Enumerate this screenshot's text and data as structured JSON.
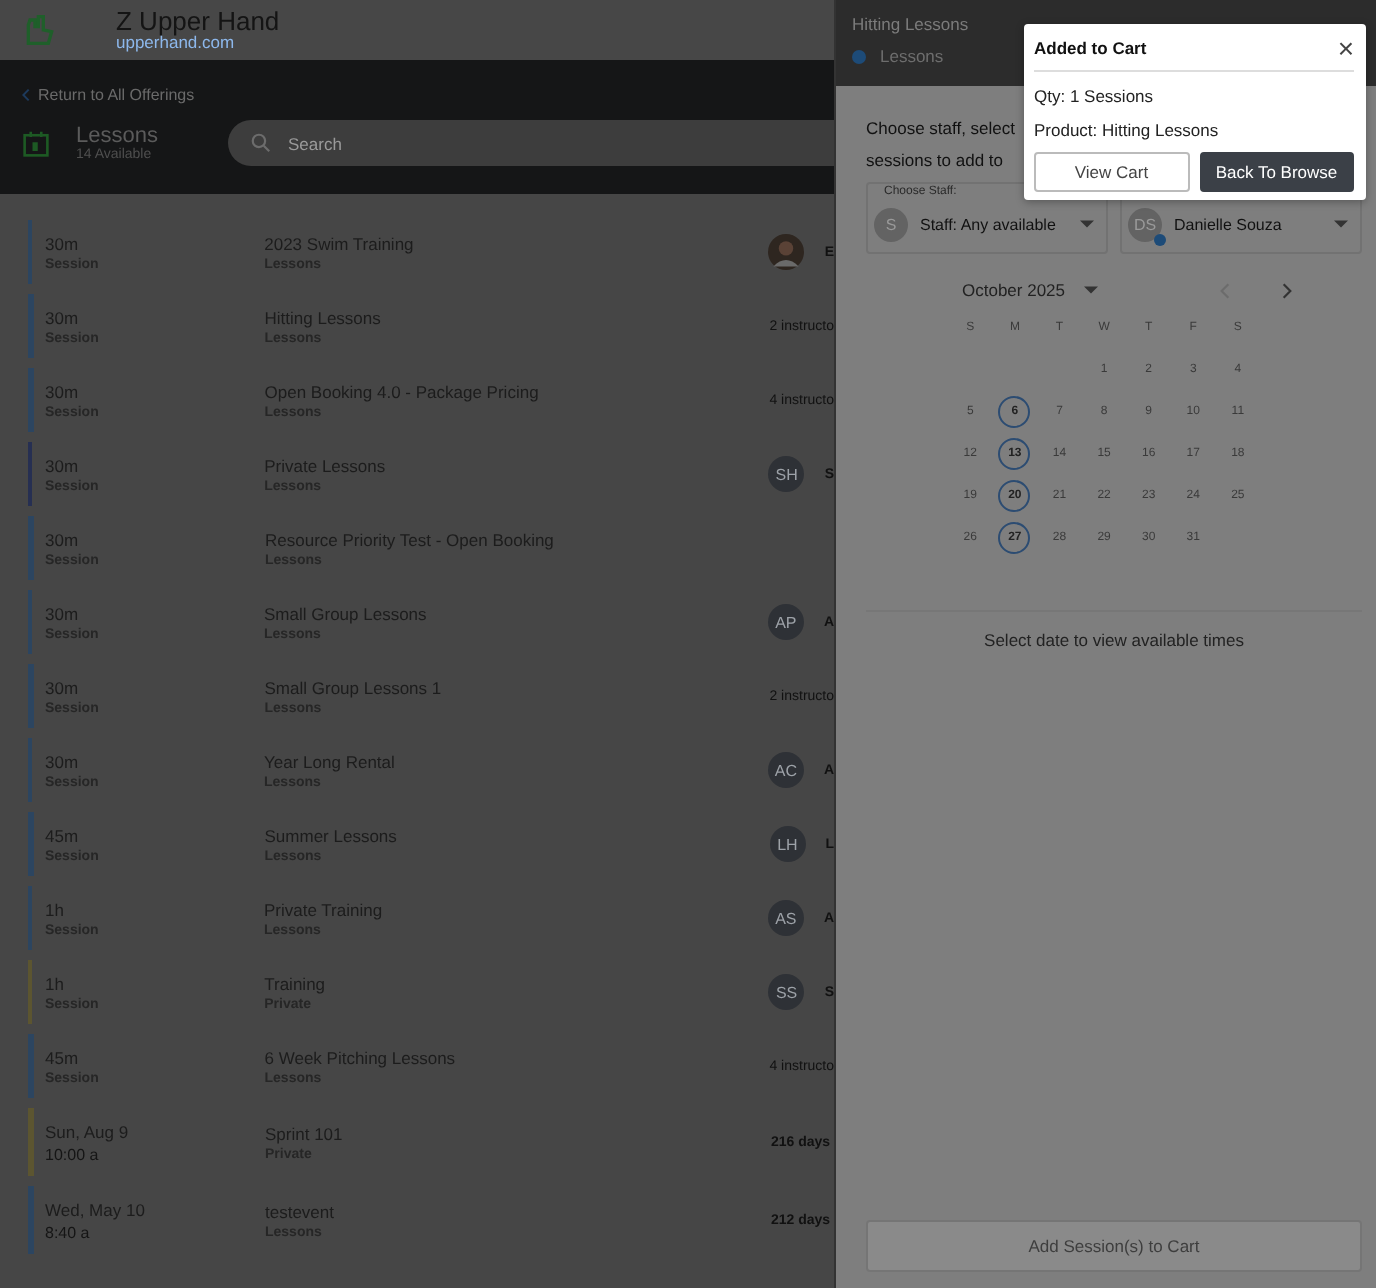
{
  "brand": {
    "name": "Z Upper Hand",
    "site": "upperhand.com"
  },
  "header": {
    "back_link": "Return to All Offerings",
    "title": "Lessons",
    "count": "14 Available",
    "search": {
      "placeholder": "Search"
    }
  },
  "rows": [
    {
      "when": "30m",
      "sub": "Session",
      "name": "2023 Swim Training",
      "category": "Lessons",
      "color": "#2c4560",
      "side": {
        "kind": "photo",
        "text": "E"
      }
    },
    {
      "when": "30m",
      "sub": "Session",
      "name": "Hitting Lessons",
      "category": "Lessons",
      "color": "#2c4560",
      "side": {
        "kind": "text",
        "text": "2 instructo"
      }
    },
    {
      "when": "30m",
      "sub": "Session",
      "name": "Open Booking 4.0 - Package Pricing",
      "category": "Lessons",
      "color": "#2c4560",
      "side": {
        "kind": "text",
        "text": "4 instructo"
      }
    },
    {
      "when": "30m",
      "sub": "Session",
      "name": "Private Lessons",
      "category": "Lessons",
      "color": "#262f52",
      "side": {
        "kind": "avatar",
        "initials": "SH",
        "text": "S"
      }
    },
    {
      "when": "30m",
      "sub": "Session",
      "name": "Resource Priority Test - Open Booking",
      "category": "Lessons",
      "color": "#2c4560"
    },
    {
      "when": "30m",
      "sub": "Session",
      "name": "Small Group Lessons",
      "category": "Lessons",
      "color": "#2c4560",
      "side": {
        "kind": "avatar",
        "initials": "AP",
        "text": "A"
      }
    },
    {
      "when": "30m",
      "sub": "Session",
      "name": "Small Group Lessons 1",
      "category": "Lessons",
      "color": "#2c4560",
      "side": {
        "kind": "text",
        "text": "2 instructo"
      }
    },
    {
      "when": "30m",
      "sub": "Session",
      "name": "Year Long Rental",
      "category": "Lessons",
      "color": "#2c4560",
      "side": {
        "kind": "avatar",
        "initials": "AC",
        "text": "A"
      }
    },
    {
      "when": "45m",
      "sub": "Session",
      "name": "Summer Lessons",
      "category": "Lessons",
      "color": "#2c4560",
      "side": {
        "kind": "avatar",
        "initials": "LH",
        "text": "L"
      }
    },
    {
      "when": "1h",
      "sub": "Session",
      "name": "Private Training",
      "category": "Lessons",
      "color": "#2c4560",
      "side": {
        "kind": "avatar",
        "initials": "AS",
        "text": "A"
      }
    },
    {
      "when": "1h",
      "sub": "Session",
      "name": "Training",
      "category": "Private",
      "color": "#5c5530",
      "side": {
        "kind": "avatar",
        "initials": "SS",
        "text": "S"
      }
    },
    {
      "when": "45m",
      "sub": "Session",
      "name": "6 Week Pitching Lessons",
      "category": "Lessons",
      "color": "#2c4560",
      "side": {
        "kind": "text",
        "text": "4 instructo"
      }
    },
    {
      "when": "Sun, Aug 9",
      "sub": "10:00 a",
      "name": "Sprint 101",
      "category": "Private",
      "color": "#5c5530",
      "side": {
        "kind": "days",
        "text": "216 days"
      }
    },
    {
      "when": "Wed, May 10",
      "sub": "8:40 a",
      "name": "testevent",
      "category": "Lessons",
      "color": "#2c4560",
      "side": {
        "kind": "days",
        "text": "212 days"
      }
    }
  ],
  "drawer": {
    "title": "Hitting Lessons",
    "category": "Lessons",
    "intro": [
      "Choose staff, select",
      "sessions to add to"
    ],
    "staff_label": "Choose Staff:",
    "staff": [
      {
        "initials": "S",
        "value": "Staff: Any available",
        "online": false
      },
      {
        "initials": "DS",
        "value": "Danielle Souza",
        "online": true
      }
    ],
    "month": "October 2025",
    "weekdays": [
      "S",
      "M",
      "T",
      "W",
      "T",
      "F",
      "S"
    ],
    "weeks": [
      [
        {
          "d": "1",
          "available": false
        },
        {
          "d": "2",
          "available": false
        },
        {
          "d": "3",
          "available": false
        },
        {
          "d": "4",
          "available": false
        }
      ],
      [
        {
          "d": "5",
          "available": false
        },
        {
          "d": "6",
          "available": true
        },
        {
          "d": "7",
          "available": false
        },
        {
          "d": "8",
          "available": false
        },
        {
          "d": "9",
          "available": false
        },
        {
          "d": "10",
          "available": false
        },
        {
          "d": "11",
          "available": false
        }
      ],
      [
        {
          "d": "12",
          "available": false
        },
        {
          "d": "13",
          "available": true
        },
        {
          "d": "14",
          "available": false
        },
        {
          "d": "15",
          "available": false
        },
        {
          "d": "16",
          "available": false
        },
        {
          "d": "17",
          "available": false
        },
        {
          "d": "18",
          "available": false
        }
      ],
      [
        {
          "d": "19",
          "available": false
        },
        {
          "d": "20",
          "available": true
        },
        {
          "d": "21",
          "available": false
        },
        {
          "d": "22",
          "available": false
        },
        {
          "d": "23",
          "available": false
        },
        {
          "d": "24",
          "available": false
        },
        {
          "d": "25",
          "available": false
        }
      ],
      [
        {
          "d": "26",
          "available": false
        },
        {
          "d": "27",
          "available": true
        },
        {
          "d": "28",
          "available": false
        },
        {
          "d": "29",
          "available": false
        },
        {
          "d": "30",
          "available": false
        },
        {
          "d": "31",
          "available": false
        }
      ]
    ],
    "hint": "Select date to view available times",
    "submit": {
      "label": "Add Session(s) to Cart",
      "disabled": true
    }
  },
  "modal": {
    "title": "Added to Cart",
    "close": "×",
    "lines": [
      "Qty: 1 Sessions",
      "Product: Hitting Lessons"
    ],
    "buttons": [
      {
        "label": "View Cart",
        "kind": "secondary"
      },
      {
        "label": "Back To Browse",
        "kind": "primary"
      }
    ]
  }
}
